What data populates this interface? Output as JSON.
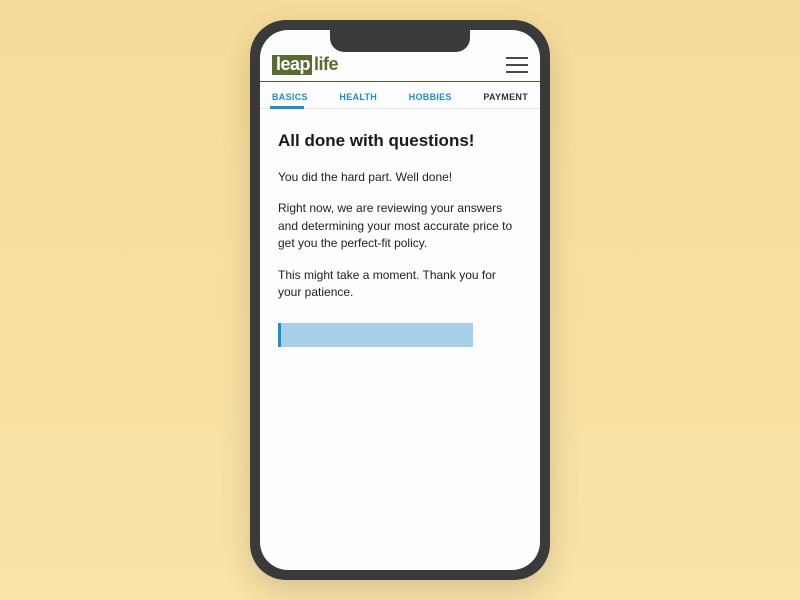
{
  "brand": {
    "part1": "leap",
    "part2": "life"
  },
  "tabs": [
    {
      "label": "BASICS",
      "active": false,
      "completed": true
    },
    {
      "label": "HEALTH",
      "active": false,
      "completed": true
    },
    {
      "label": "HOBBIES",
      "active": false,
      "completed": true
    },
    {
      "label": "PAYMENT",
      "active": true,
      "completed": false
    }
  ],
  "content": {
    "title": "All done with questions!",
    "para1": "You did the hard part. Well done!",
    "para2": "Right now, we are reviewing your answers and determining your most accurate price to get you the perfect-fit policy.",
    "para3": "This might take a moment. Thank you for your patience."
  },
  "progress": {
    "percent": 80
  },
  "colors": {
    "accent": "#1891d0",
    "brand": "#5a6b2f",
    "progressFill": "#a7cfe8"
  }
}
